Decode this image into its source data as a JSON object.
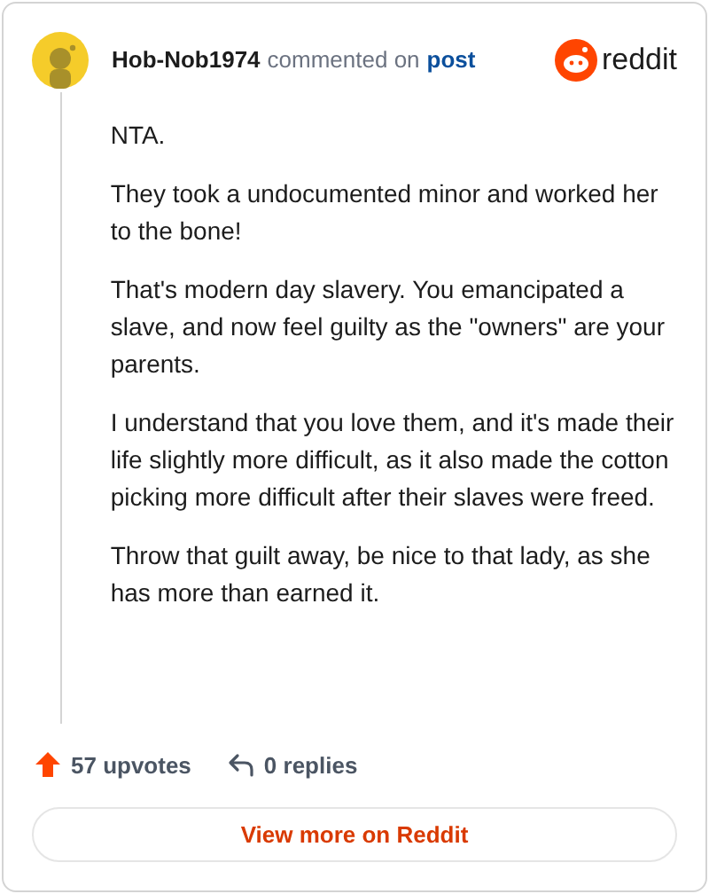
{
  "header": {
    "username": "Hob-Nob1974",
    "action": "commented on",
    "link": "post",
    "brand": "reddit"
  },
  "body": [
    "NTA.",
    "They took a undocumented minor and worked her to the bone!",
    "That's modern day slavery. You emancipated a slave, and now feel guilty as the \"owners\" are your parents.",
    "I understand that you love them, and it's made their life slightly more difficult, as it also made the cotton picking more difficult after their slaves were freed.",
    "Throw that guilt away, be nice to that lady, as she has more than earned it."
  ],
  "footer": {
    "upvotes": "57 upvotes",
    "replies": "0 replies"
  },
  "button": "View more on Reddit"
}
